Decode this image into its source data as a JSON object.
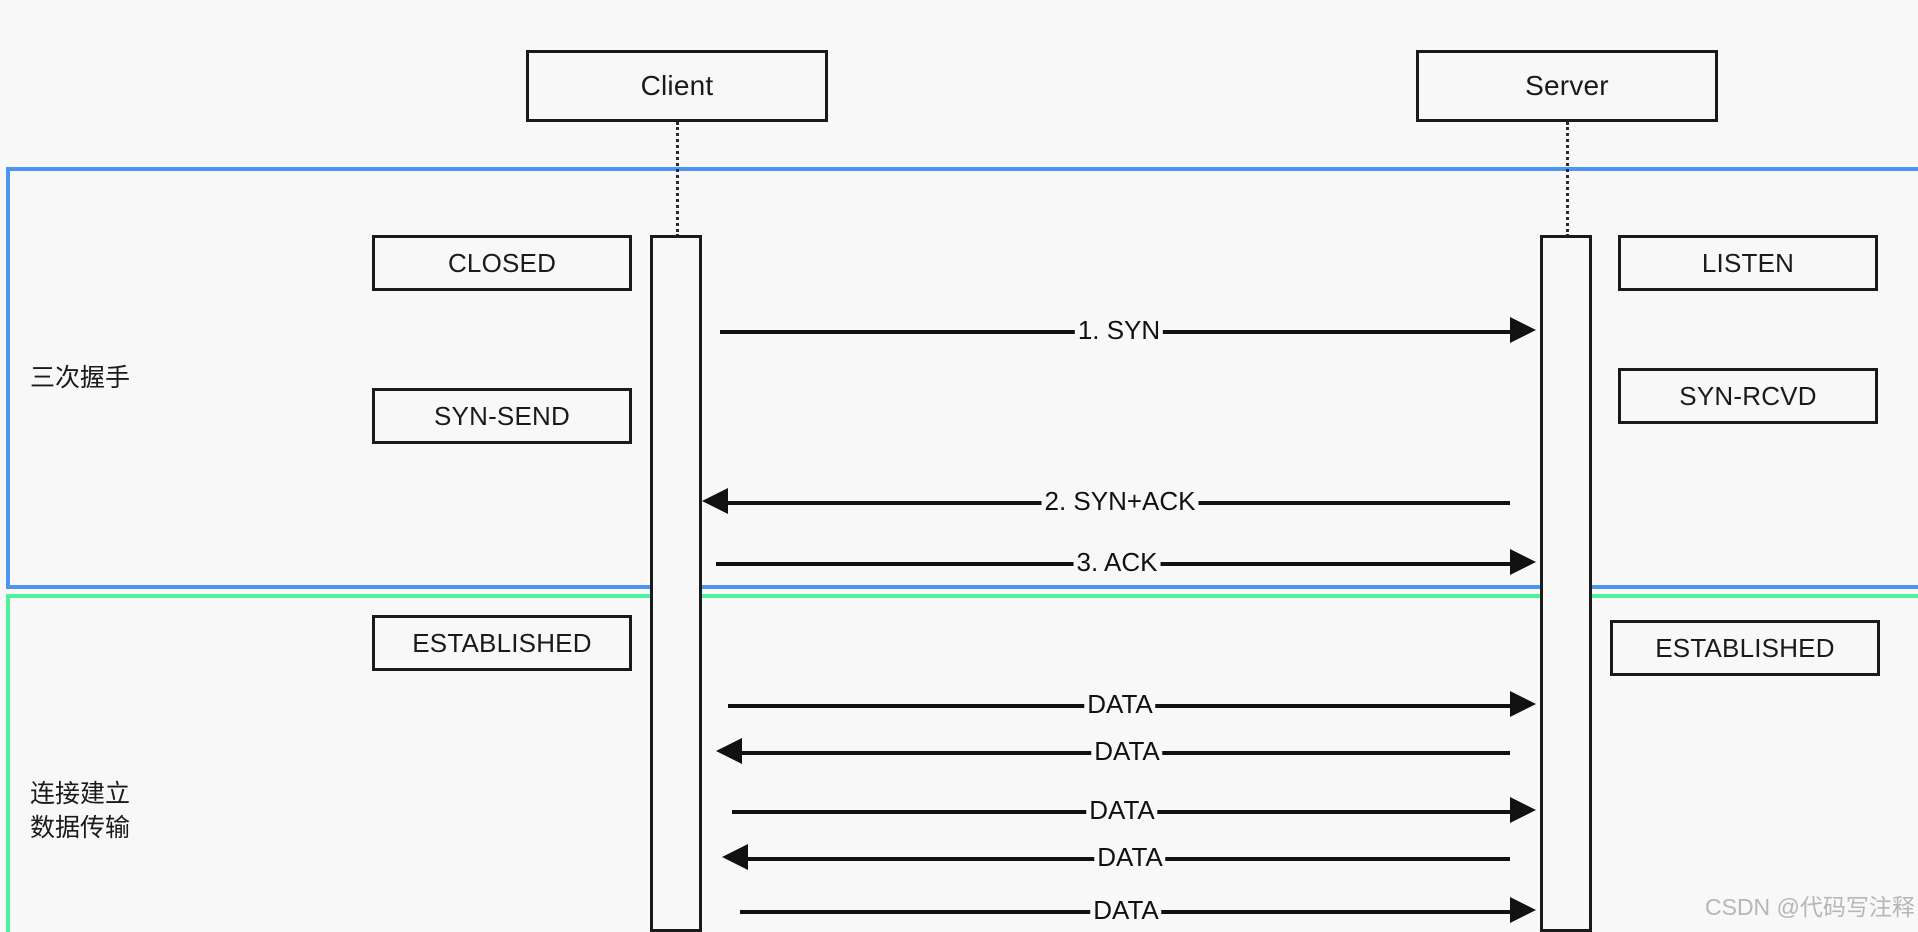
{
  "diagram": {
    "type": "sequence-diagram",
    "background": "#f8f8f8",
    "line_color": "#111111"
  },
  "participants": [
    {
      "id": "client",
      "label": "Client"
    },
    {
      "id": "server",
      "label": "Server"
    }
  ],
  "groups": [
    {
      "id": "handshake",
      "label": "三次握手",
      "color": "#4d95f2"
    },
    {
      "id": "data-transfer",
      "label": "连接建立\n数据传输",
      "color": "#4ff29a"
    }
  ],
  "states": {
    "client": [
      {
        "label": "CLOSED"
      },
      {
        "label": "SYN-SEND"
      },
      {
        "label": "ESTABLISHED"
      }
    ],
    "server": [
      {
        "label": "LISTEN"
      },
      {
        "label": "SYN-RCVD"
      },
      {
        "label": "ESTABLISHED"
      }
    ]
  },
  "messages": [
    {
      "label": "1. SYN",
      "direction": "right",
      "arrowhead": true
    },
    {
      "label": "2. SYN+ACK",
      "direction": "left",
      "arrowhead": true
    },
    {
      "label": "3. ACK",
      "direction": "right",
      "arrowhead": true
    },
    {
      "label": "DATA",
      "direction": "right",
      "arrowhead": true
    },
    {
      "label": "DATA",
      "direction": "left",
      "arrowhead": true
    },
    {
      "label": "DATA",
      "direction": "right",
      "arrowhead": true
    },
    {
      "label": "DATA",
      "direction": "left",
      "arrowhead": true
    },
    {
      "label": "DATA",
      "direction": "right",
      "arrowhead": true
    }
  ],
  "watermark": {
    "text": "CSDN @代码写注释"
  }
}
